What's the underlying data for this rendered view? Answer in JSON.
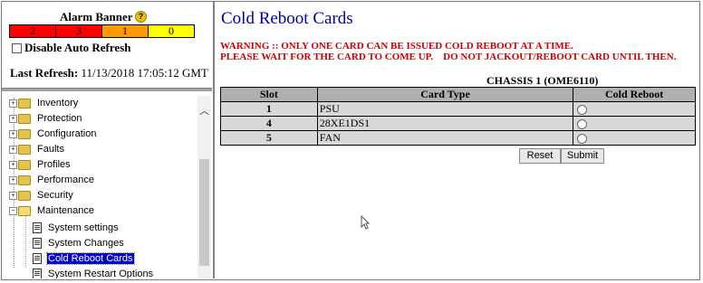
{
  "alarm": {
    "title": "Alarm Banner",
    "help_icon": "?",
    "counts": [
      {
        "value": "2",
        "color": "#ff0000"
      },
      {
        "value": "3",
        "color": "#ff0000"
      },
      {
        "value": "1",
        "color": "#ff9900"
      },
      {
        "value": "0",
        "color": "#ffff00"
      }
    ],
    "disable_refresh_label": "Disable Auto Refresh",
    "last_refresh_label": "Last Refresh:",
    "last_refresh_value": "11/13/2018 17:05:12 GMT"
  },
  "tree": {
    "items": [
      {
        "label": "Inventory",
        "type": "folder",
        "expanded": false
      },
      {
        "label": "Protection",
        "type": "folder",
        "expanded": false
      },
      {
        "label": "Configuration",
        "type": "folder",
        "expanded": false
      },
      {
        "label": "Faults",
        "type": "folder",
        "expanded": false
      },
      {
        "label": "Profiles",
        "type": "folder",
        "expanded": false
      },
      {
        "label": "Performance",
        "type": "folder",
        "expanded": false
      },
      {
        "label": "Security",
        "type": "folder",
        "expanded": false
      },
      {
        "label": "Maintenance",
        "type": "folder",
        "expanded": true
      },
      {
        "label": "System settings",
        "type": "doc"
      },
      {
        "label": "System Changes",
        "type": "doc"
      },
      {
        "label": "Cold Reboot Cards",
        "type": "doc",
        "selected": true
      },
      {
        "label": "System Restart Options",
        "type": "doc"
      }
    ]
  },
  "main": {
    "title": "Cold Reboot Cards",
    "warning_line1": "WARNING :: ONLY ONE CARD CAN BE ISSUED COLD REBOOT AT A TIME.",
    "warning_line2": "PLEASE WAIT FOR THE CARD TO COME UP.    DO NOT JACKOUT/REBOOT CARD UNTIL THEN.",
    "chassis_label": "CHASSIS 1 (OME6110)",
    "table": {
      "headers": [
        "Slot",
        "Card Type",
        "Cold Reboot"
      ],
      "rows": [
        {
          "slot": "1",
          "card_type": "PSU"
        },
        {
          "slot": "4",
          "card_type": "28XE1DS1"
        },
        {
          "slot": "5",
          "card_type": "FAN"
        }
      ]
    },
    "reset_label": "Reset",
    "submit_label": "Submit"
  }
}
